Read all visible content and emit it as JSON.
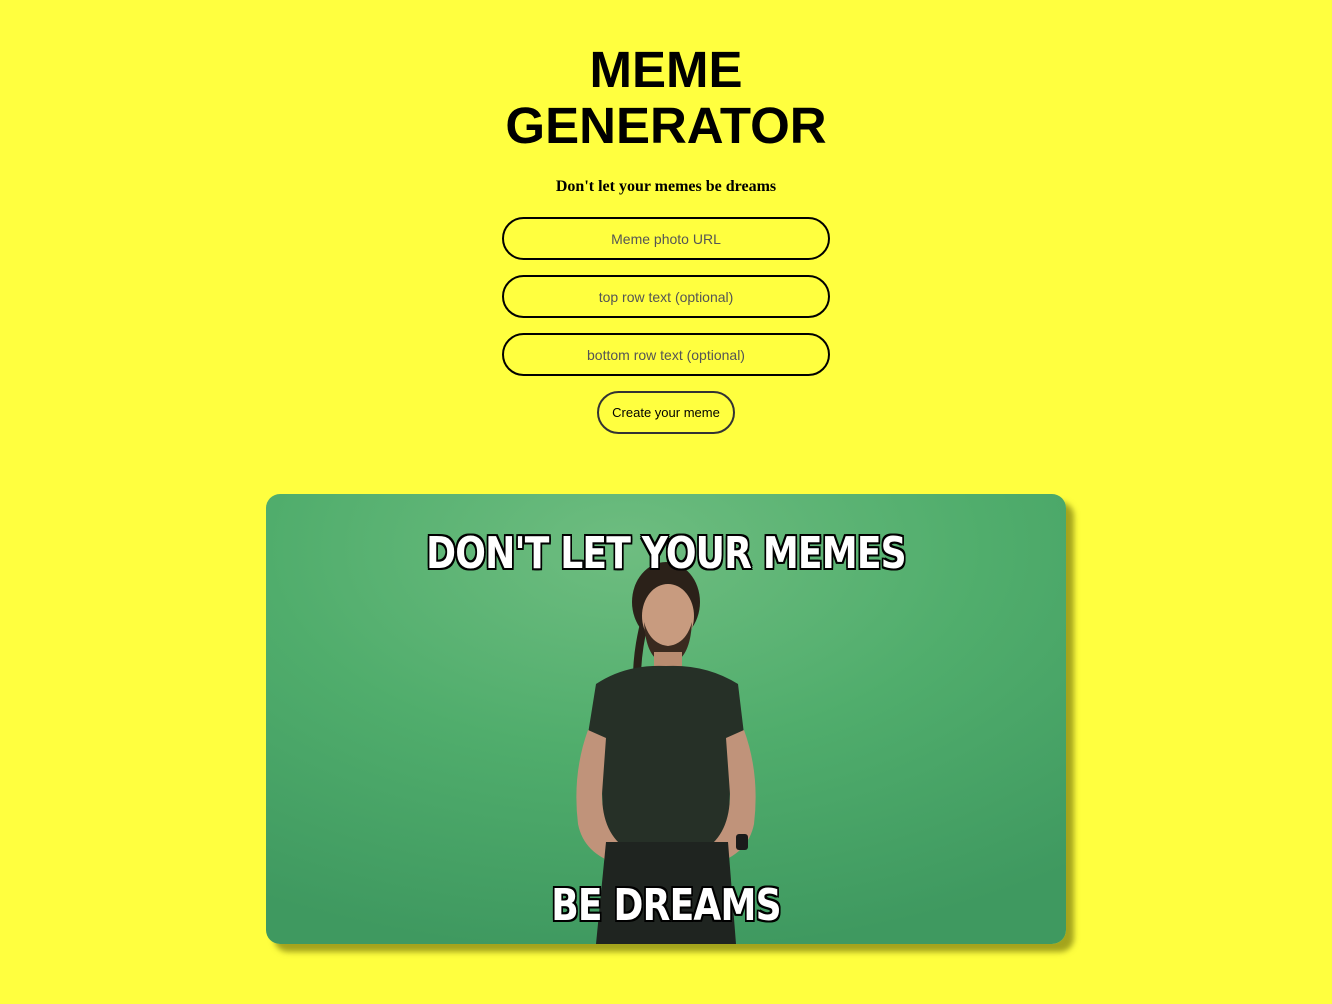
{
  "header": {
    "title_line1": "MEME",
    "title_line2": "GENERATOR",
    "subtitle": "Don't let your memes be dreams"
  },
  "form": {
    "url_placeholder": "Meme photo URL",
    "top_placeholder": "top row text (optional)",
    "bottom_placeholder": "bottom row text (optional)",
    "submit_label": "Create your meme"
  },
  "meme": {
    "top_text": "DON'T LET YOUR MEMES",
    "bottom_text": "BE DREAMS",
    "alt": "meme image"
  },
  "colors": {
    "background": "#ffff3f",
    "meme_backdrop": "#4fab6a"
  }
}
